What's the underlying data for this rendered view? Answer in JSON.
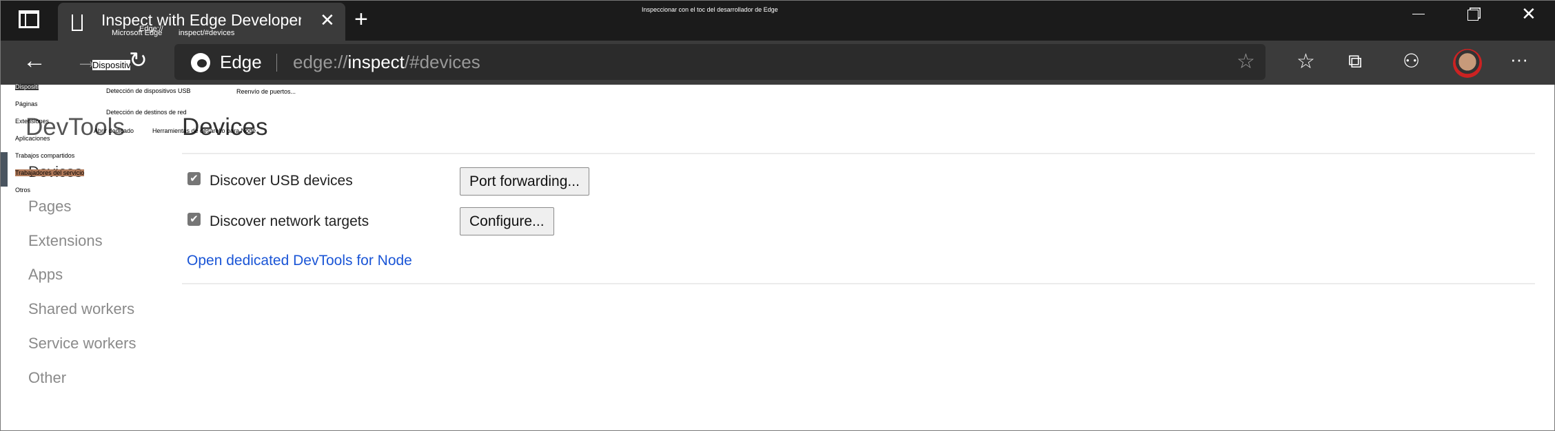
{
  "window": {
    "caption": "Inspeccionar con el toc del desarrollador de Edge"
  },
  "tab": {
    "title": "Inspect with Edge Developer Tools",
    "overlay_labels": [
      "Microsoft Edge",
      "Edge://",
      "inspect/#devices"
    ]
  },
  "toolbar": {
    "forward_tooltip": "Dispositivos",
    "brand": "Edge",
    "url_scheme": "edge://",
    "url_host": "inspect",
    "url_path": "/#devices"
  },
  "overlay": {
    "sidebar": [
      "Dispositi",
      "Páginas",
      "Extensiones",
      "Aplicaciones",
      "Trabajos compartidos",
      "Trabajadores del servicio",
      "Otros"
    ],
    "usb": "Detección de dispositivos USB",
    "port": "Reenvío de puertos...",
    "network": "Detección de destinos de red",
    "open": "Abrir dedicado",
    "node": "Herramientas de desarollo para Node"
  },
  "page": {
    "app_title": "DevTools",
    "section_title": "Devices",
    "sidebar": [
      "Devices",
      "Pages",
      "Extensions",
      "Apps",
      "Shared workers",
      "Service workers",
      "Other"
    ],
    "discover_usb": {
      "label": "Discover USB devices",
      "checked": true
    },
    "discover_network": {
      "label": "Discover network targets",
      "checked": true
    },
    "port_forwarding": "Port forwarding...",
    "configure": "Configure...",
    "node_link": "Open dedicated DevTools for Node"
  },
  "colors": {
    "link": "#1a55d6",
    "titlebar": "#1b1b1b",
    "toolbar": "#3b3b3b"
  }
}
